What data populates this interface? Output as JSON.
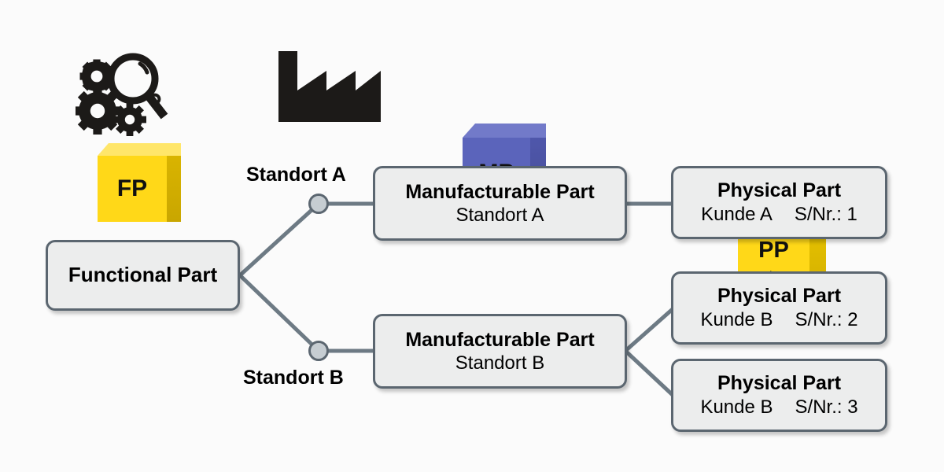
{
  "page": {
    "background_color": "#fbfbfb",
    "diagram_type": "part-hierarchy-tree"
  },
  "legend": {
    "items": [
      {
        "id": "fp",
        "icon_name": "gears-magnifier-icon",
        "cube_label": "FP",
        "cube_sublabel": "",
        "cube_color": "#ffd818",
        "cube_top_color": "#ffe66a",
        "cube_side_color": "#d9b400"
      },
      {
        "id": "mp",
        "icon_name": "factory-icon",
        "cube_label": "MP",
        "cube_sublabel": "",
        "cube_color": "#5b64bb",
        "cube_top_color": "#727ac9",
        "cube_side_color": "#4a52a0"
      },
      {
        "id": "pp",
        "icon_name": "",
        "cube_label": "PP",
        "cube_sublabel": "S/Nr.",
        "cube_color": "#ffd818",
        "cube_top_color": "#ffe66a",
        "cube_side_color": "#d9b400"
      }
    ]
  },
  "tree": {
    "root": {
      "title": "Functional Part",
      "subtitle": ""
    },
    "branch_labels": [
      {
        "id": "standort-a",
        "text": "Standort A"
      },
      {
        "id": "standort-b",
        "text": "Standort B"
      }
    ],
    "manufacturable_parts": [
      {
        "id": "mp-a",
        "title": "Manufacturable Part",
        "subtitle": "Standort A"
      },
      {
        "id": "mp-b",
        "title": "Manufacturable Part",
        "subtitle": "Standort B"
      }
    ],
    "physical_parts": [
      {
        "id": "pp-1",
        "title": "Physical Part",
        "customer": "Kunde A",
        "serial": "S/Nr.: 1"
      },
      {
        "id": "pp-2",
        "title": "Physical Part",
        "customer": "Kunde B",
        "serial": "S/Nr.: 2"
      },
      {
        "id": "pp-3",
        "title": "Physical Part",
        "customer": "Kunde B",
        "serial": "S/Nr.: 3"
      }
    ]
  },
  "colors": {
    "node_fill": "#eceded",
    "node_border": "#5b6670",
    "connector": "#6d7a84",
    "junction_fill": "#c6cdd2",
    "icon_black": "#1c1a18",
    "yellow": "#ffd818",
    "blue": "#5b64bb"
  }
}
